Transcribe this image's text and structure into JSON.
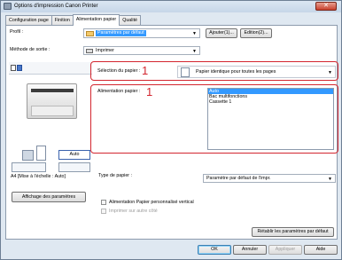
{
  "window": {
    "title": "Options d'impression Canon Printer"
  },
  "tabs": [
    "Configuration page",
    "Finition",
    "Alimentation papier",
    "Qualité"
  ],
  "active_tab_index": 2,
  "profile": {
    "label": "Profil :",
    "value": "Paramètres par défaut",
    "add_button": "Ajouter(1)...",
    "edit_button": "Edition(2)..."
  },
  "output": {
    "label": "Méthode de sortie :",
    "value": "Imprimer"
  },
  "paper_selection": {
    "label": "Sélection du papier :",
    "value": "Papier identique pour toutes les pages",
    "marker": "1"
  },
  "paper_source": {
    "label": "Alimentation papier :",
    "marker": "1",
    "options": [
      "Auto",
      "Bac multifonctions",
      "Cassette 1"
    ],
    "selected_index": 0
  },
  "preview": {
    "source_value": "Auto",
    "size_caption": "A4 [Mise à l'échelle : Auto]"
  },
  "paper_type": {
    "label": "Type de papier :",
    "value": "Paramètre par défaut de l'impr."
  },
  "view_settings_button": "Affichage des paramètres",
  "custom_feed": {
    "label": "Alimentation Papier personnalisé vertical",
    "checked": false
  },
  "print_other_side": {
    "label": "Imprimer sur autre côté",
    "checked": false,
    "enabled": false
  },
  "restore_defaults_button": "Rétablir les paramètres par défaut",
  "footer": {
    "ok": "OK",
    "cancel": "Annuler",
    "apply": "Appliquer",
    "help": "Aide"
  },
  "colors": {
    "accent_red": "#d3262f",
    "selection_blue": "#3399ff"
  }
}
